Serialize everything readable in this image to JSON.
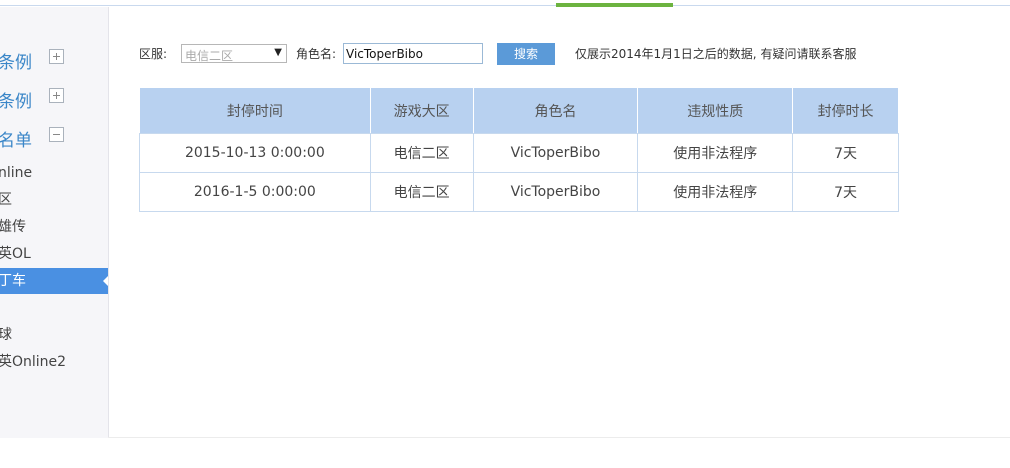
{
  "sidebar": {
    "sections": [
      {
        "label": "条例",
        "toggle": "+"
      },
      {
        "label": "条例",
        "toggle": "+"
      },
      {
        "label": "名单",
        "toggle": "−"
      }
    ],
    "items": [
      {
        "label": "nline"
      },
      {
        "label": "区"
      },
      {
        "label": "雄传"
      },
      {
        "label": "英OL"
      },
      {
        "label": "丁车",
        "active": true
      },
      {
        "label": ""
      },
      {
        "label": "球"
      },
      {
        "label": "英Online2"
      }
    ]
  },
  "filter": {
    "region_label": "区服:",
    "region_value": "电信二区",
    "role_label": "角色名:",
    "role_value": "VicToperBibo",
    "search_label": "搜索",
    "note": "仅展示2014年1月1日之后的数据, 有疑问请联系客服"
  },
  "table": {
    "headers": [
      "封停时间",
      "游戏大区",
      "角色名",
      "违规性质",
      "封停时长"
    ],
    "rows": [
      [
        "2015-10-13 0:00:00",
        "电信二区",
        "VicToperBibo",
        "使用非法程序",
        "7天"
      ],
      [
        "2016-1-5 0:00:00",
        "电信二区",
        "VicToperBibo",
        "使用非法程序",
        "7天"
      ]
    ]
  },
  "colors": {
    "accent_blue": "#4a90e2",
    "header_bg": "#b8d1f0",
    "tab_green": "#6cb33f"
  }
}
